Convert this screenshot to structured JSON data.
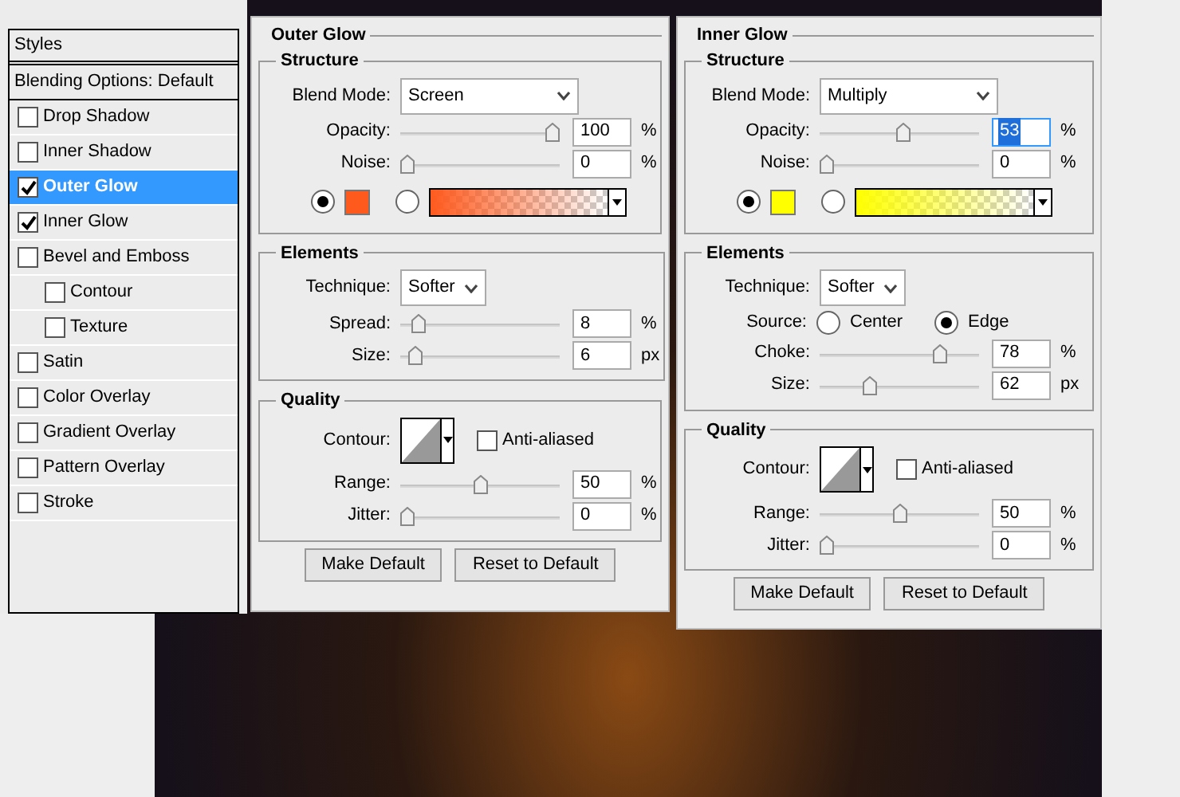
{
  "styles_panel": {
    "header": "Styles",
    "blending_options": "Blending Options: Default",
    "items": [
      {
        "label": "Drop Shadow",
        "checked": false,
        "selected": false
      },
      {
        "label": "Inner Shadow",
        "checked": false,
        "selected": false
      },
      {
        "label": "Outer Glow",
        "checked": true,
        "selected": true
      },
      {
        "label": "Inner Glow",
        "checked": true,
        "selected": false
      },
      {
        "label": "Bevel and Emboss",
        "checked": false,
        "selected": false,
        "children": [
          {
            "label": "Contour",
            "checked": false,
            "selected": false
          },
          {
            "label": "Texture",
            "checked": false,
            "selected": false
          }
        ]
      },
      {
        "label": "Satin",
        "checked": false,
        "selected": false
      },
      {
        "label": "Color Overlay",
        "checked": false,
        "selected": false
      },
      {
        "label": "Gradient Overlay",
        "checked": false,
        "selected": false
      },
      {
        "label": "Pattern Overlay",
        "checked": false,
        "selected": false
      },
      {
        "label": "Stroke",
        "checked": false,
        "selected": false
      }
    ]
  },
  "panels": [
    {
      "title": "Outer Glow",
      "sections": [
        {
          "title": "Structure",
          "rows": [
            {
              "kind": "dropdown",
              "label": "Blend Mode:",
              "value": "Screen"
            },
            {
              "kind": "slider",
              "label": "Opacity:",
              "level": 1,
              "value": "100",
              "unit": "%",
              "focused": false
            },
            {
              "kind": "slider",
              "label": "Noise:",
              "level": 0,
              "value": "0",
              "unit": "%",
              "focused": false
            },
            {
              "kind": "color",
              "color": "#ff5a1e",
              "options": [
                {
                  "kind": "swatch",
                  "selected": true
                },
                {
                  "kind": "gradient",
                  "selected": false
                }
              ]
            }
          ]
        },
        {
          "title": "Elements",
          "rows": [
            {
              "kind": "dropdown",
              "label": "Technique:",
              "value": "Softer"
            },
            {
              "kind": "slider",
              "label": "Spread:",
              "level": 0.08,
              "value": "8",
              "unit": "%",
              "focused": false
            },
            {
              "kind": "slider",
              "label": "Size:",
              "level": 0.06,
              "value": "6",
              "unit": "px",
              "focused": false
            }
          ]
        },
        {
          "title": "Quality",
          "rows": [
            {
              "kind": "contour",
              "label": "Contour:",
              "checkbox": {
                "label": "Anti-aliased",
                "checked": false
              }
            },
            {
              "kind": "slider",
              "label": "Range:",
              "level": 0.5,
              "value": "50",
              "unit": "%",
              "focused": false
            },
            {
              "kind": "slider",
              "label": "Jitter:",
              "level": 0,
              "value": "0",
              "unit": "%",
              "focused": false
            }
          ]
        }
      ],
      "buttons": [
        "Make Default",
        "Reset to Default"
      ]
    },
    {
      "title": "Inner Glow",
      "sections": [
        {
          "title": "Structure",
          "rows": [
            {
              "kind": "dropdown",
              "label": "Blend Mode:",
              "value": "Multiply"
            },
            {
              "kind": "slider",
              "label": "Opacity:",
              "level": 0.53,
              "value": "53",
              "unit": "%",
              "focused": true
            },
            {
              "kind": "slider",
              "label": "Noise:",
              "level": 0,
              "value": "0",
              "unit": "%",
              "focused": false
            },
            {
              "kind": "color",
              "color": "#ffff00",
              "options": [
                {
                  "kind": "swatch",
                  "selected": true
                },
                {
                  "kind": "gradient",
                  "selected": false
                }
              ]
            }
          ]
        },
        {
          "title": "Elements",
          "rows": [
            {
              "kind": "dropdown",
              "label": "Technique:",
              "value": "Softer"
            },
            {
              "kind": "radio",
              "label": "Source:",
              "options": [
                {
                  "label": "Center",
                  "selected": false
                },
                {
                  "label": "Edge",
                  "selected": true
                }
              ]
            },
            {
              "kind": "slider",
              "label": "Choke:",
              "level": 0.78,
              "value": "78",
              "unit": "%",
              "focused": false
            },
            {
              "kind": "slider",
              "label": "Size:",
              "level": 0.3,
              "value": "62",
              "unit": "px",
              "focused": false
            }
          ]
        },
        {
          "title": "Quality",
          "rows": [
            {
              "kind": "contour",
              "label": "Contour:",
              "checkbox": {
                "label": "Anti-aliased",
                "checked": false
              }
            },
            {
              "kind": "slider",
              "label": "Range:",
              "level": 0.5,
              "value": "50",
              "unit": "%",
              "focused": false
            },
            {
              "kind": "slider",
              "label": "Jitter:",
              "level": 0,
              "value": "0",
              "unit": "%",
              "focused": false
            }
          ]
        }
      ],
      "buttons": [
        "Make Default",
        "Reset to Default"
      ]
    }
  ]
}
